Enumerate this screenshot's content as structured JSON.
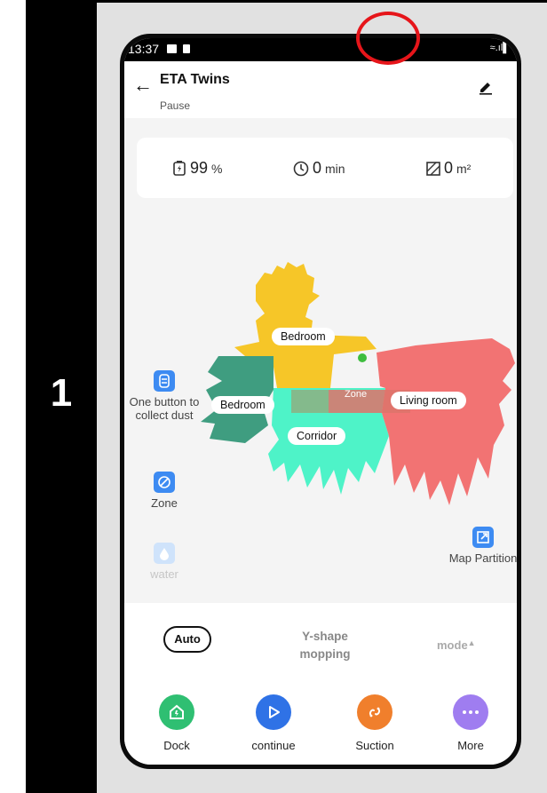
{
  "step": {
    "number": "1"
  },
  "status_bar": {
    "time": "13:37"
  },
  "header": {
    "title": "ETA Twins",
    "status": "Pause"
  },
  "stats": {
    "battery": {
      "value": "99",
      "unit": "%"
    },
    "time": {
      "value": "0",
      "unit": "min"
    },
    "area": {
      "value": "0",
      "unit": "m²"
    }
  },
  "map": {
    "rooms": [
      "Bedroom",
      "Bedroom",
      "Zone",
      "Living room",
      "Corridor"
    ],
    "colors": {
      "bedroom_top": "#f6c628",
      "bedroom_left": "#3f9d80",
      "corridor": "#4ef3c8",
      "living": "#f27373",
      "zone": "#b18a5b"
    }
  },
  "side_controls": {
    "collect_dust": "One button to collect dust",
    "zone": "Zone",
    "water": "water",
    "map_partition": "Map Partition"
  },
  "mode": {
    "auto_label": "Auto",
    "mopping_label": "Y-shape mopping",
    "mode_label": "mode"
  },
  "actions": [
    {
      "label": "Dock",
      "color": "#2fbf72",
      "icon": "home-icon"
    },
    {
      "label": "continue",
      "color": "#2f72e6",
      "icon": "play-icon"
    },
    {
      "label": "Suction",
      "color": "#f07f2c",
      "icon": "link-icon"
    },
    {
      "label": "More",
      "color": "#9f7df0",
      "icon": "more-icon"
    }
  ]
}
